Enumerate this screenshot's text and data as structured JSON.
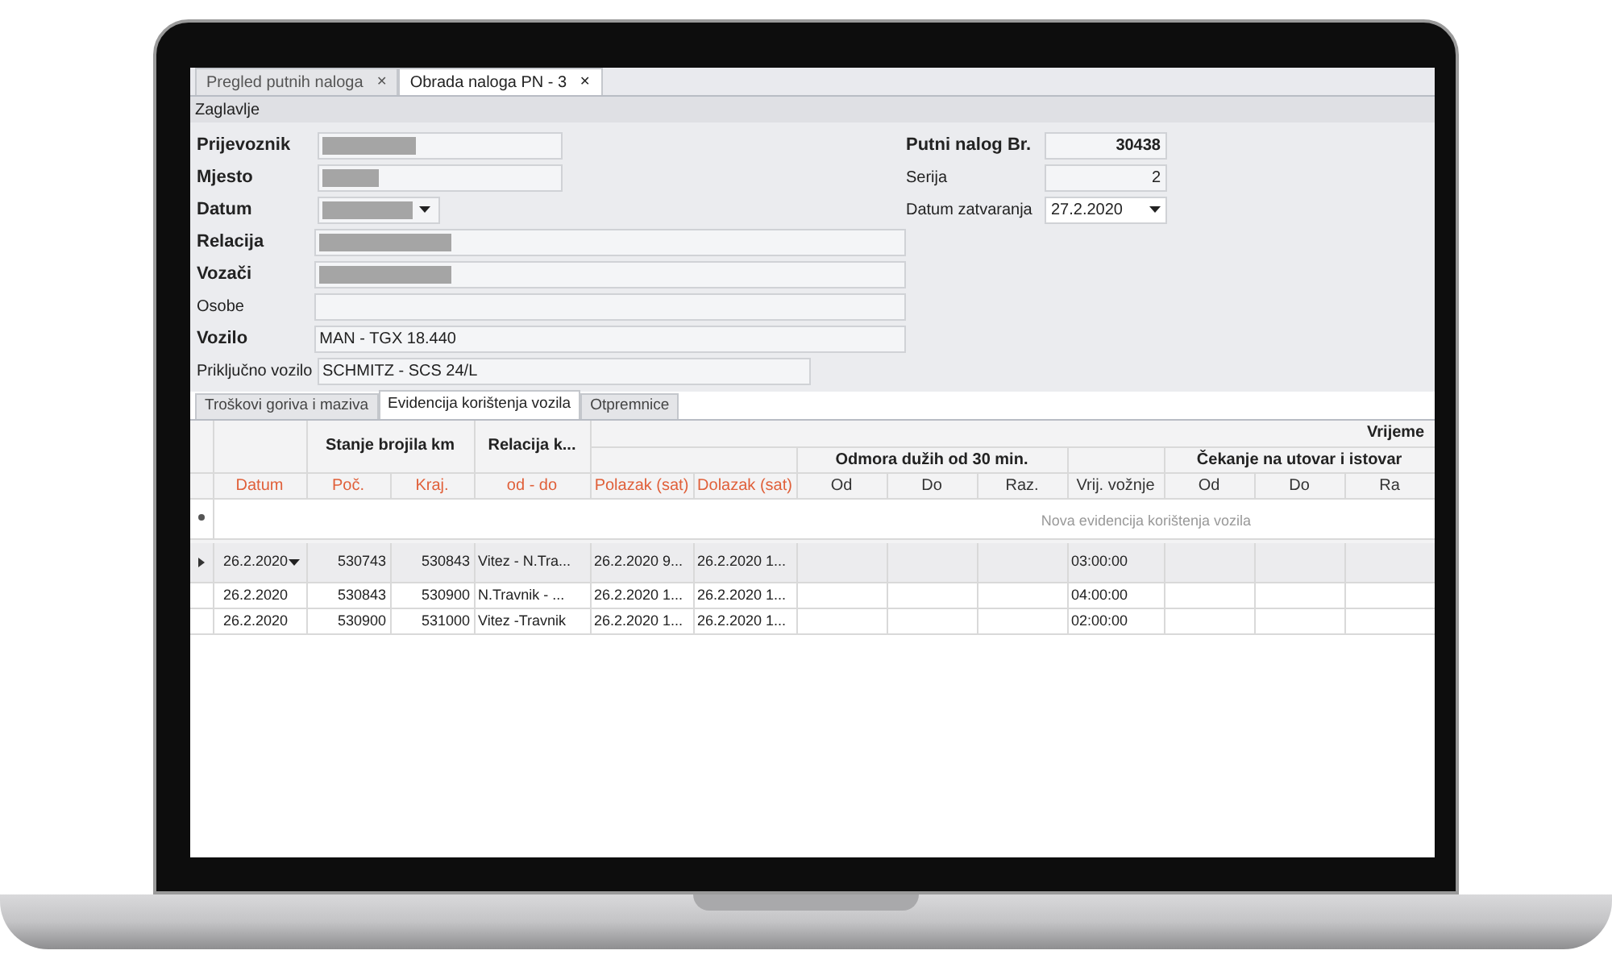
{
  "tabs": [
    {
      "label": "Pregled putnih naloga",
      "selected": false,
      "close": "✕"
    },
    {
      "label": "Obrada naloga PN - 3",
      "selected": true,
      "close": "✕"
    }
  ],
  "section_title": "Zaglavlje",
  "left_fields": [
    {
      "label": "Prijevoznik",
      "required": true,
      "kind": "text",
      "redacted": true
    },
    {
      "label": "Mjesto",
      "required": true,
      "kind": "text",
      "redacted": true
    },
    {
      "label": "Datum",
      "required": true,
      "kind": "dropdown",
      "redacted": true
    },
    {
      "label": "Relacija",
      "required": true,
      "kind": "text",
      "redacted": true
    },
    {
      "label": "Vozači",
      "required": true,
      "kind": "text",
      "redacted": true
    },
    {
      "label": "Osobe",
      "required": false,
      "kind": "text",
      "redacted": false
    },
    {
      "label": "Vozilo",
      "required": true,
      "kind": "text",
      "redacted": false,
      "value": "MAN - TGX 18.440"
    },
    {
      "label": "Priključno vozilo",
      "required": false,
      "kind": "text",
      "redacted": false,
      "value": "SCHMITZ - SCS 24/L"
    }
  ],
  "right_fields": [
    {
      "label": "Putni nalog Br.",
      "required": true,
      "kind": "number",
      "value": "30438"
    },
    {
      "label": "Serija",
      "required": false,
      "kind": "number",
      "value": "2"
    },
    {
      "label": "Datum zatvaranja",
      "required": false,
      "kind": "dropdown",
      "value": "27.2.2020"
    }
  ],
  "detail_tabs": [
    {
      "label": "Troškovi goriva i maziva",
      "selected": false
    },
    {
      "label": "Evidencija korištenja vozila",
      "selected": true
    },
    {
      "label": "Otpremnice",
      "selected": false
    }
  ],
  "grid": {
    "group_top": "Vrijeme",
    "group_stanje": "Stanje brojila km",
    "group_relacija": "Relacija k...",
    "group_odmor": "Odmora dužih od 30 min.",
    "group_cekanje": "Čekanje na utovar i istovar",
    "columns": [
      "Datum",
      "Poč.",
      "Kraj.",
      "od - do",
      "Polazak (sat)",
      "Dolazak (sat)",
      "Od",
      "Do",
      "Raz.",
      "Vrij. vožnje",
      "Od",
      "Do",
      "Ra"
    ],
    "new_row_placeholder": "Nova evidencija korištenja vozila",
    "rows": [
      {
        "selected": true,
        "cells": [
          "26.2.2020",
          "530743",
          "530843",
          "Vitez - N.Tra...",
          "26.2.2020 9...",
          "26.2.2020 1...",
          "",
          "",
          "",
          "03:00:00",
          "",
          "",
          ""
        ]
      },
      {
        "selected": false,
        "cells": [
          "26.2.2020",
          "530843",
          "530900",
          "N.Travnik - ...",
          "26.2.2020 1...",
          "26.2.2020 1...",
          "",
          "",
          "",
          "04:00:00",
          "",
          "",
          ""
        ]
      },
      {
        "selected": false,
        "cells": [
          "26.2.2020",
          "530900",
          "531000",
          "Vitez -Travnik",
          "26.2.2020 1...",
          "26.2.2020 1...",
          "",
          "",
          "",
          "02:00:00",
          "",
          "",
          ""
        ]
      }
    ]
  }
}
